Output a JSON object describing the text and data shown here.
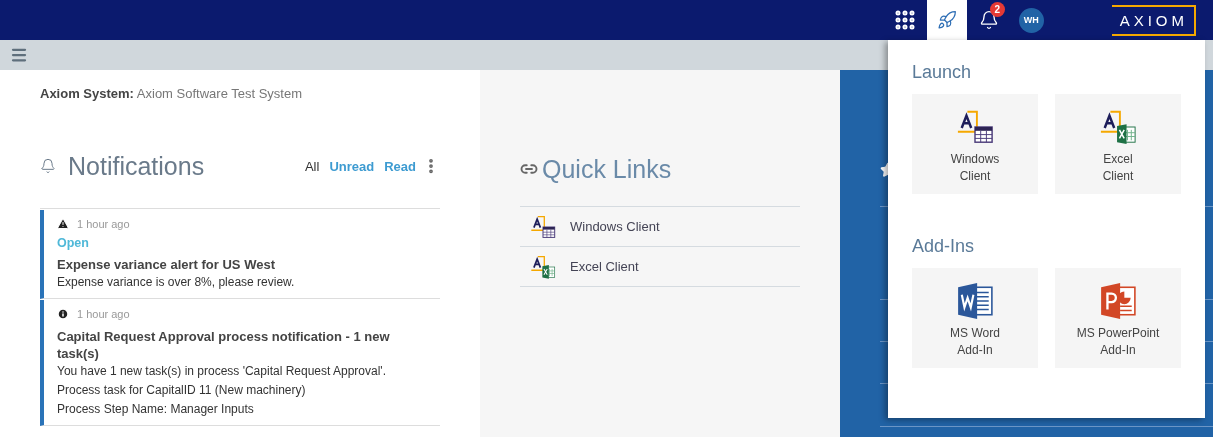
{
  "header": {
    "launcher_open": true,
    "notification_count": "2",
    "avatar": "WH",
    "logo": "AXIOM"
  },
  "system": {
    "label": "Axiom System:",
    "value": "Axiom Software Test System"
  },
  "notifications": {
    "title": "Notifications",
    "filters": [
      {
        "label": "All",
        "selected": true
      },
      {
        "label": "Unread",
        "selected": false
      },
      {
        "label": "Read",
        "selected": false
      }
    ],
    "items": [
      {
        "kind": "warning",
        "time": "1 hour ago",
        "status": "Open",
        "title": "Expense variance alert for US West",
        "body": [
          "Expense variance is over 8%, please review."
        ]
      },
      {
        "kind": "info",
        "time": "1 hour ago",
        "title": "Capital Request Approval process notification - 1 new task(s)",
        "body": [
          "You have 1 new task(s) in process 'Capital Request Approval'.",
          "Process task for CapitalID 11 (New machinery)",
          "Process Step Name: Manager Inputs"
        ]
      }
    ]
  },
  "quick_links": {
    "title": "Quick Links",
    "items": [
      {
        "kind": "windows",
        "label": "Windows Client"
      },
      {
        "kind": "excel",
        "label": "Excel Client"
      }
    ]
  },
  "launcher": {
    "sections": [
      {
        "title": "Launch",
        "items": [
          {
            "kind": "windows",
            "lines": [
              "Windows",
              "Client"
            ]
          },
          {
            "kind": "excel",
            "lines": [
              "Excel",
              "Client"
            ]
          }
        ]
      },
      {
        "title": "Add-Ins",
        "items": [
          {
            "kind": "word",
            "lines": [
              "MS Word",
              "Add-In"
            ]
          },
          {
            "kind": "powerpoint",
            "lines": [
              "MS PowerPoint",
              "Add-In"
            ]
          }
        ]
      }
    ]
  }
}
